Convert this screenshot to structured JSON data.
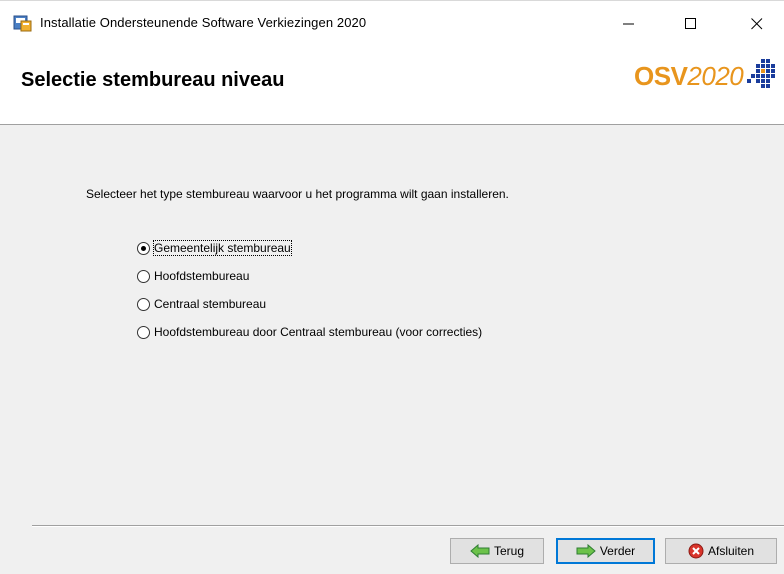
{
  "window": {
    "title": "Installatie Ondersteunende Software Verkiezingen 2020"
  },
  "header": {
    "title": "Selectie stembureau niveau",
    "logo_text_bold": "OSV",
    "logo_text_year": "2020"
  },
  "content": {
    "instruction": "Selecteer het type stembureau waarvoor u het programma wilt gaan installeren.",
    "options": [
      {
        "label": "Gemeentelijk stembureau",
        "selected": true
      },
      {
        "label": "Hoofdstembureau",
        "selected": false
      },
      {
        "label": "Centraal stembureau",
        "selected": false
      },
      {
        "label": "Hoofdstembureau door Centraal stembureau (voor correcties)",
        "selected": false
      }
    ]
  },
  "footer": {
    "back_label": "Terug",
    "next_label": "Verder",
    "exit_label": "Afsluiten"
  },
  "colors": {
    "logo_orange": "#e8951d",
    "logo_blue": "#1a3c9c",
    "default_button_border": "#0078d7",
    "arrow_green": "#4caf50",
    "exit_red": "#d32f2f"
  },
  "icons": {
    "app": "installer-icon",
    "back": "arrow-left-icon",
    "next": "arrow-right-icon",
    "exit": "close-circle-icon"
  }
}
